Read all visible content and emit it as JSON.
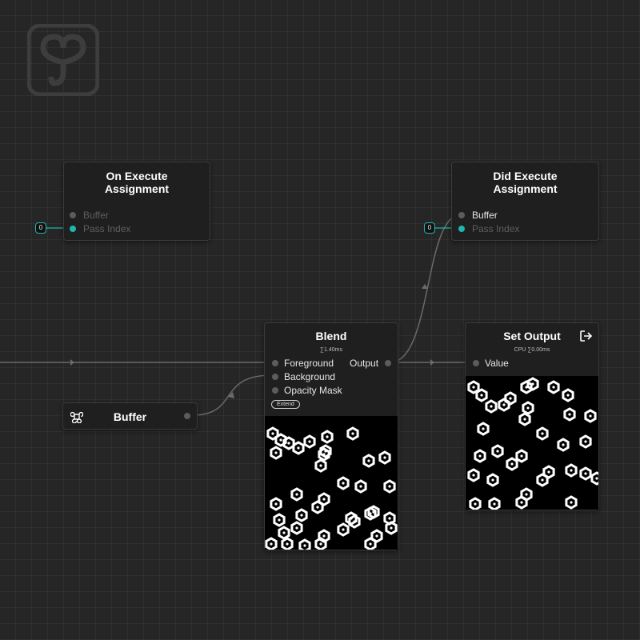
{
  "nodes": {
    "on_execute": {
      "title_line1": "On Execute",
      "title_line2": "Assignment",
      "ports": {
        "buffer": "Buffer",
        "pass_index": "Pass Index"
      },
      "pass_index_value": "0"
    },
    "did_execute": {
      "title_line1": "Did Execute",
      "title_line2": "Assignment",
      "ports": {
        "buffer": "Buffer",
        "pass_index": "Pass Index"
      },
      "pass_index_value": "0"
    },
    "blend": {
      "title": "Blend",
      "timing": "∑1.40ms",
      "inputs": {
        "foreground": "Foreground",
        "background": "Background",
        "opacity_mask": "Opacity Mask"
      },
      "output": "Output",
      "mode_badge": "Extend"
    },
    "set_output": {
      "title": "Set Output",
      "timing": "CPU ∑0.00ms",
      "input": "Value"
    },
    "buffer": {
      "title": "Buffer"
    }
  },
  "colors": {
    "background": "#262626",
    "node_body": "#1f1f1f",
    "accent_teal": "#1fb5b0",
    "port_inactive": "#5c5c5c",
    "wire": "#6f6f6f"
  },
  "icons": {
    "logo": "app-logo-icon",
    "buffer_node": "command-icon",
    "set_output": "exit-icon"
  }
}
